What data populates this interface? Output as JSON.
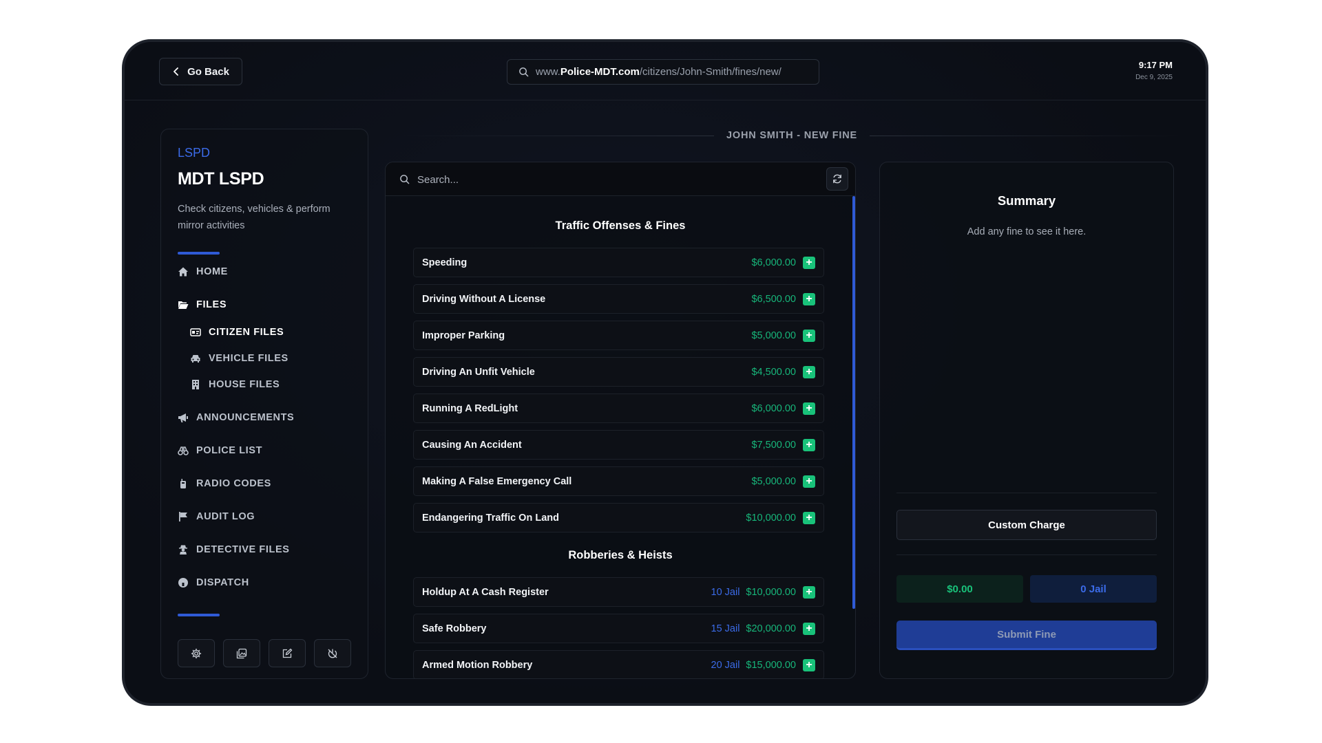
{
  "topbar": {
    "go_back_label": "Go Back",
    "url_prefix": "www.",
    "url_domain": "Police-MDT.com",
    "url_path": "/citizens/John-Smith/fines/new/",
    "time": "9:17 PM",
    "date": "Dec 9, 2025"
  },
  "sidebar": {
    "brand": "LSPD",
    "title": "MDT LSPD",
    "description": "Check citizens, vehicles & perform mirror activities",
    "accent_color": "#2f5ad6",
    "items": [
      {
        "label": "HOME",
        "icon": "home-icon"
      },
      {
        "label": "FILES",
        "icon": "folder-open-icon"
      },
      {
        "label": "CITIZEN FILES",
        "icon": "id-card-icon"
      },
      {
        "label": "VEHICLE FILES",
        "icon": "car-icon"
      },
      {
        "label": "HOUSE FILES",
        "icon": "building-icon"
      },
      {
        "label": "ANNOUNCEMENTS",
        "icon": "megaphone-icon"
      },
      {
        "label": "POLICE LIST",
        "icon": "binoculars-icon"
      },
      {
        "label": "RADIO CODES",
        "icon": "radio-icon"
      },
      {
        "label": "AUDIT LOG",
        "icon": "flag-icon"
      },
      {
        "label": "DETECTIVE FILES",
        "icon": "detective-icon"
      },
      {
        "label": "DISPATCH",
        "icon": "headset-icon"
      }
    ],
    "footer_buttons": [
      "settings-icon",
      "images-icon",
      "edit-icon",
      "power-off-icon"
    ]
  },
  "heading": "JOHN SMITH - NEW FINE",
  "search": {
    "placeholder": "Search..."
  },
  "categories": [
    {
      "title": "Traffic Offenses & Fines",
      "fines": [
        {
          "name": "Speeding",
          "price": "$6,000.00"
        },
        {
          "name": "Driving Without A License",
          "price": "$6,500.00"
        },
        {
          "name": "Improper Parking",
          "price": "$5,000.00"
        },
        {
          "name": "Driving An Unfit Vehicle",
          "price": "$4,500.00"
        },
        {
          "name": "Running A RedLight",
          "price": "$6,000.00"
        },
        {
          "name": "Causing An Accident",
          "price": "$7,500.00"
        },
        {
          "name": "Making A False Emergency Call",
          "price": "$5,000.00"
        },
        {
          "name": "Endangering Traffic On Land",
          "price": "$10,000.00"
        }
      ]
    },
    {
      "title": "Robberies & Heists",
      "fines": [
        {
          "name": "Holdup At A Cash Register",
          "jail": "10 Jail",
          "price": "$10,000.00"
        },
        {
          "name": "Safe Robbery",
          "jail": "15 Jail",
          "price": "$20,000.00"
        },
        {
          "name": "Armed Motion Robbery",
          "jail": "20 Jail",
          "price": "$15,000.00"
        }
      ]
    }
  ],
  "summary": {
    "title": "Summary",
    "empty_text": "Add any fine to see it here.",
    "custom_charge_label": "Custom Charge",
    "total_money": "$0.00",
    "total_jail": "0 Jail",
    "submit_label": "Submit Fine"
  },
  "colors": {
    "money": "#19c27a",
    "jail": "#3b6be8",
    "accent": "#2f5ad6"
  }
}
